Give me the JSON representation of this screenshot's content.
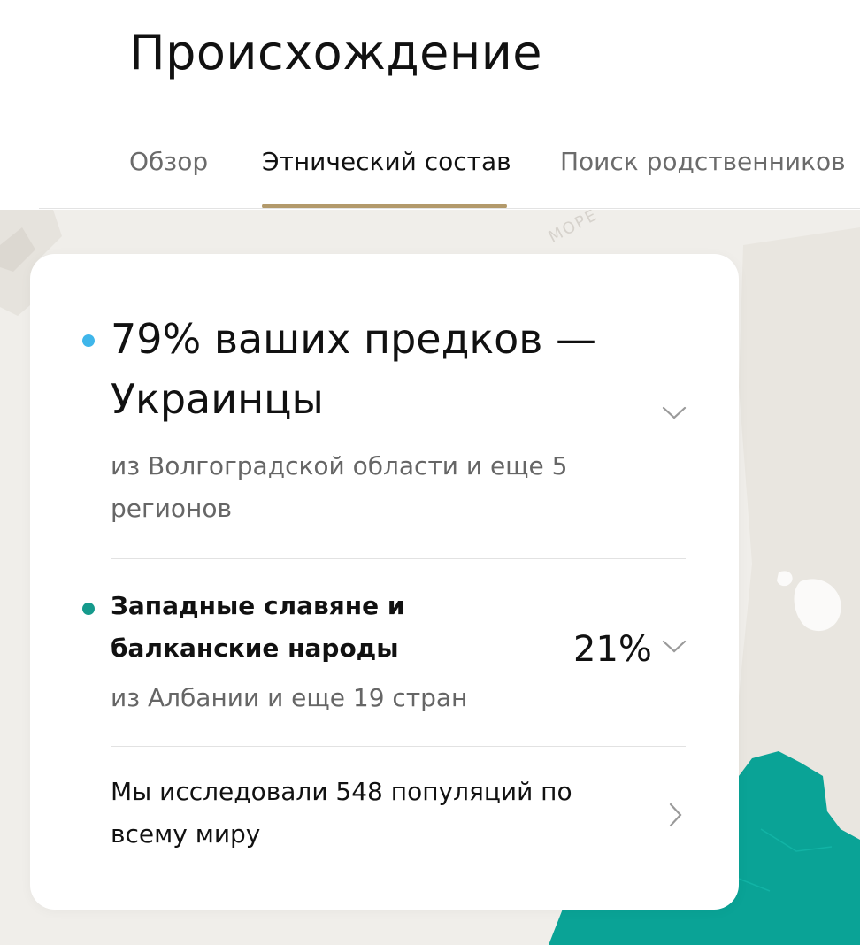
{
  "header": {
    "title": "Происхождение",
    "tabs": [
      {
        "label": "Обзор",
        "active": false
      },
      {
        "label": "Этнический состав",
        "active": true
      },
      {
        "label": "Поиск родственников",
        "active": false
      }
    ]
  },
  "map": {
    "sea_label": "МОРЕ"
  },
  "card": {
    "primary": {
      "heading": "79% ваших предков — Украинцы",
      "subtitle": "из Волгоградской области и еще 5 регионов",
      "dot_color": "#3fb6ea"
    },
    "secondary": {
      "name": "Западные славяне и балканские народы",
      "percent": "21%",
      "subtitle": "из Албании и еще 19 стран",
      "dot_color": "#159a8c"
    },
    "footer_link": "Мы исследовали 548 популяций по всему миру"
  },
  "colors": {
    "tab_underline": "#b39a6b",
    "map_background": "#f0eeea",
    "map_region": "#0aa396"
  },
  "icons": [
    "chevron-down-icon",
    "chevron-down-icon",
    "chevron-right-icon"
  ]
}
